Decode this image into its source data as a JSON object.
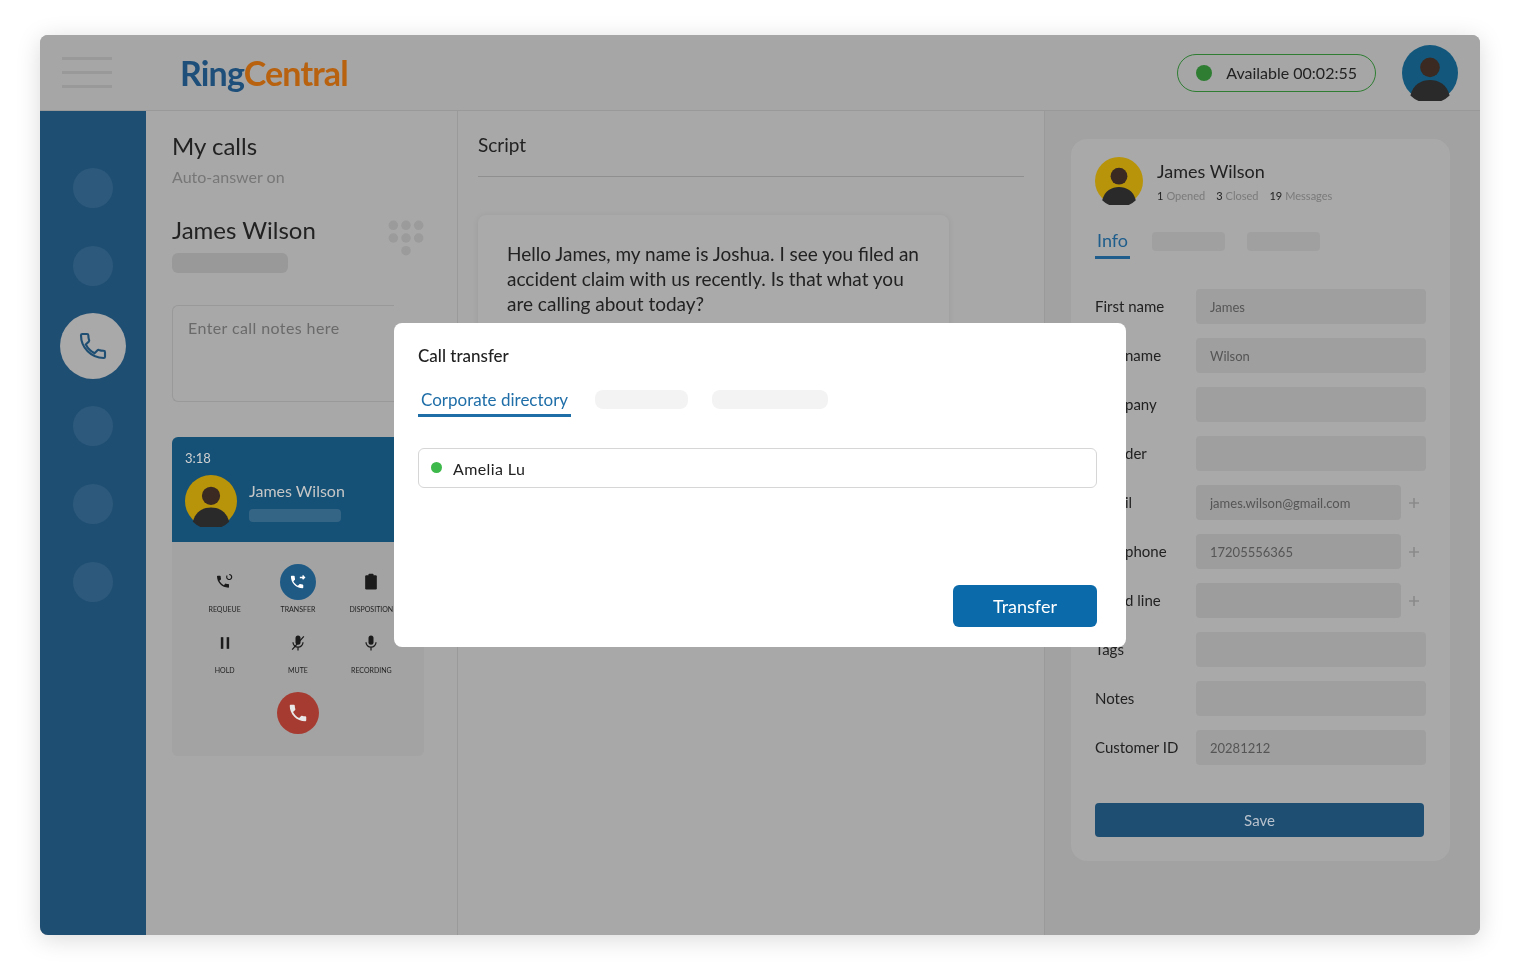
{
  "header": {
    "logo": {
      "part_1": "Ring",
      "part_2": "Central"
    },
    "status": {
      "label": "Available 00:02:55",
      "color": "#2e7d32"
    }
  },
  "sidebar": {
    "items": [
      {
        "kind": "blank",
        "selected": false
      },
      {
        "kind": "blank",
        "selected": false
      },
      {
        "kind": "phone",
        "selected": true
      },
      {
        "kind": "blank",
        "selected": false
      },
      {
        "kind": "blank",
        "selected": false
      },
      {
        "kind": "blank",
        "selected": false
      }
    ]
  },
  "my_calls": {
    "title": "My calls",
    "subtitle": "Auto-answer on",
    "caller": "James Wilson",
    "notes": {
      "placeholder": "Enter call notes here"
    },
    "call_card": {
      "timer": "3:18",
      "caller": "James Wilson",
      "actions": [
        {
          "kind": "requeue",
          "label": "REQUEUE",
          "selected": false
        },
        {
          "kind": "transfer",
          "label": "TRANSFER",
          "selected": true
        },
        {
          "kind": "disposition",
          "label": "DISPOSITION",
          "selected": false
        },
        {
          "kind": "hold",
          "label": "HOLD",
          "selected": false
        },
        {
          "kind": "mute",
          "label": "MUTE",
          "selected": false
        },
        {
          "kind": "recording",
          "label": "RECORDING",
          "selected": false
        }
      ]
    }
  },
  "script": {
    "title": "Script",
    "text": "Hello James, my name is Joshua. I see you filed an accident claim with us recently. Is that what you are calling about today?"
  },
  "contact": {
    "name": "James Wilson",
    "stats": [
      {
        "count": "1",
        "label": "Opened"
      },
      {
        "count": "3",
        "label": "Closed"
      },
      {
        "count": "19",
        "label": "Messages"
      }
    ],
    "tabs": [
      {
        "kind": "text",
        "label": "Info",
        "selected": true
      },
      {
        "kind": "placeholder",
        "selected": false
      },
      {
        "kind": "placeholder",
        "selected": false
      }
    ],
    "fields": [
      {
        "label": "First name",
        "value": "James",
        "cut": false,
        "add": false
      },
      {
        "label": "name",
        "value": "Wilson",
        "cut": true,
        "add": false
      },
      {
        "label": "pany",
        "cut": true,
        "add": false
      },
      {
        "label": "der",
        "cut": true,
        "add": false
      },
      {
        "label": "il",
        "value": "james.wilson@gmail.com",
        "cut": true,
        "add": true
      },
      {
        "label": "phone",
        "value": "17205556365",
        "cut": true,
        "add": true
      },
      {
        "label": "d line",
        "cut": true,
        "add": true
      },
      {
        "label": "Tags",
        "cut": false,
        "add": false
      },
      {
        "label": "Notes",
        "cut": false,
        "add": false
      },
      {
        "label": "Customer ID",
        "value": "20281212",
        "cut": false,
        "add": false
      }
    ],
    "save": "Save"
  },
  "dialog": {
    "title": "Call transfer",
    "tabs": [
      {
        "kind": "text",
        "label": "Corporate directory",
        "selected": true
      },
      {
        "kind": "placeholder",
        "selected": false
      },
      {
        "kind": "placeholder",
        "selected": false
      }
    ],
    "search": {
      "value": "Amelia Lu",
      "color": "#3db84a"
    },
    "button": "Transfer"
  }
}
